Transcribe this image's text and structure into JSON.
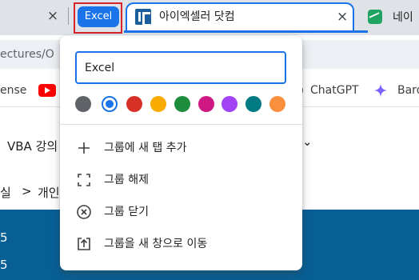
{
  "tabstrip": {
    "prev_tab_close": "×",
    "group_chip_label": "Excel",
    "active_tab": {
      "title": "아이엑셀러 닷컴",
      "close": "×"
    },
    "next_tab": {
      "title": "네이"
    }
  },
  "address_bar": {
    "url_fragment": "ectures/O"
  },
  "bookmarks": {
    "partial_left": "ense",
    "chatgpt": "ChatGPT",
    "bard": "Bard"
  },
  "page": {
    "nav_text": "VBA 강의",
    "nav_caret": "⌄",
    "breadcrumb_left": "실",
    "breadcrumb_sep": ">",
    "breadcrumb_item": "개인",
    "band_numbers": [
      "5",
      "5"
    ]
  },
  "popup": {
    "group_name_value": "Excel",
    "colors": [
      "#5f6368",
      "#1a73e8",
      "#d93025",
      "#f9ab00",
      "#1e8e3e",
      "#d01884",
      "#a142f4",
      "#007b83",
      "#fa903e"
    ],
    "selected_color_index": 1,
    "menu": [
      {
        "label": "그룹에 새 탭 추가",
        "icon": "plus-icon"
      },
      {
        "label": "그룹 해제",
        "icon": "ungroup-icon"
      },
      {
        "label": "그룹 닫기",
        "icon": "close-circle-icon"
      },
      {
        "label": "그룹을 새 창으로 이동",
        "icon": "open-in-new-window-icon"
      }
    ]
  }
}
